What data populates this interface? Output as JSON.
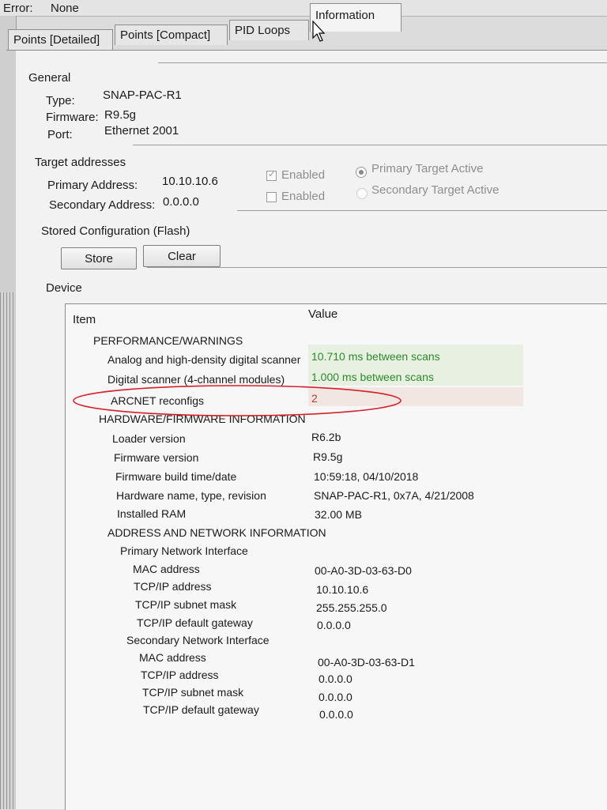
{
  "error": {
    "label": "Error:",
    "value": "None"
  },
  "tabs": [
    {
      "label": "Points [Detailed]"
    },
    {
      "label": "Points [Compact]"
    },
    {
      "label": "PID Loops"
    },
    {
      "label": "Information"
    }
  ],
  "general": {
    "title": "General",
    "type_label": "Type:",
    "type_value": "SNAP-PAC-R1",
    "firmware_label": "Firmware:",
    "firmware_value": "R9.5g",
    "port_label": "Port:",
    "port_value": "Ethernet 2001"
  },
  "targets": {
    "title": "Target addresses",
    "primary_label": "Primary Address:",
    "primary_value": "10.10.10.6",
    "secondary_label": "Secondary Address:",
    "secondary_value": "0.0.0.0",
    "enabled_label": "Enabled",
    "primary_active_label": "Primary Target Active",
    "secondary_active_label": "Secondary Target Active"
  },
  "stored": {
    "title": "Stored Configuration (Flash)",
    "store_label": "Store",
    "clear_label": "Clear"
  },
  "device": {
    "title": "Device",
    "col_item": "Item",
    "col_value": "Value",
    "rows": [
      {
        "item": "PERFORMANCE/WARNINGS",
        "value": ""
      },
      {
        "item": "Analog and high-density digital scanner",
        "value": "10.710 ms between scans"
      },
      {
        "item": "Digital scanner (4-channel modules)",
        "value": "1.000 ms between scans"
      },
      {
        "item": "ARCNET reconfigs",
        "value": "2"
      },
      {
        "item": "HARDWARE/FIRMWARE INFORMATION",
        "value": ""
      },
      {
        "item": "Loader version",
        "value": "R6.2b"
      },
      {
        "item": "Firmware version",
        "value": "R9.5g"
      },
      {
        "item": "Firmware build time/date",
        "value": "10:59:18, 04/10/2018"
      },
      {
        "item": "Hardware name, type, revision",
        "value": "SNAP-PAC-R1, 0x7A, 4/21/2008"
      },
      {
        "item": "Installed RAM",
        "value": "32.00 MB"
      },
      {
        "item": "ADDRESS AND NETWORK INFORMATION",
        "value": ""
      },
      {
        "item": "Primary Network Interface",
        "value": ""
      },
      {
        "item": "MAC address",
        "value": "00-A0-3D-03-63-D0"
      },
      {
        "item": "TCP/IP address",
        "value": "10.10.10.6"
      },
      {
        "item": "TCP/IP subnet mask",
        "value": "255.255.255.0"
      },
      {
        "item": "TCP/IP default gateway",
        "value": "0.0.0.0"
      },
      {
        "item": "Secondary Network Interface",
        "value": ""
      },
      {
        "item": "MAC address",
        "value": "00-A0-3D-03-63-D1"
      },
      {
        "item": "TCP/IP address",
        "value": "0.0.0.0"
      },
      {
        "item": "TCP/IP subnet mask",
        "value": "0.0.0.0"
      },
      {
        "item": "TCP/IP default gateway",
        "value": "0.0.0.0"
      }
    ]
  },
  "colors": {
    "green_value": "#2c8a2c",
    "red_value": "#c0392b",
    "annotation": "#d81f2a"
  },
  "icons": {
    "cursor": "mouse-pointer-icon"
  }
}
